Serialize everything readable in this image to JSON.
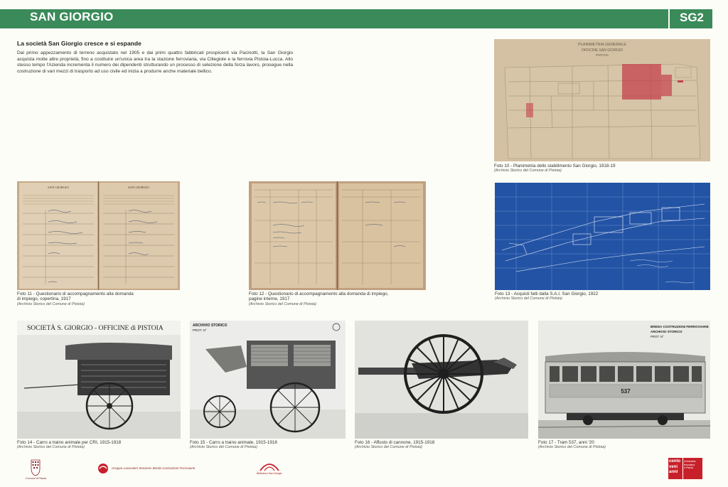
{
  "header": {
    "title": "SAN GIORGIO",
    "code": "SG2"
  },
  "section": {
    "subtitle": "La società San Giorgio cresce e si espande",
    "intro": "Dal primo appezzamento di terreno acquistato nel 1905 e dai primi quattro fabbricati prospicenti via Pacinotti, la San Giorgio acquista molte altre proprietà, fino a costituire un'unica area tra la stazione ferroviaria, via Ciliegiole e la ferrovia Pistoia-Lucca. Allo stesso tempo l'Azienda incrementa il numero dei dipendenti strutturando un processo di selezione della forza lavoro, prosegue nella costruzione di vari mezzi di trasporto ad uso civile ed inizia a produrre anche materiale bellico."
  },
  "photos": {
    "f10": {
      "caption": "Foto 10 - Planimetria dello stabilimento San Giorgio, 1918-19",
      "source": "(Archivio Storico del Comune di Pistoia)",
      "doc_title": "PLANIMETRIA GENERALE",
      "doc_sub": "OFFICINE SAN GIORGIO",
      "doc_city": "PISTOIA"
    },
    "f11": {
      "caption_line1": "Foto 11 - Questionario di accompagnamento alla domanda",
      "caption_line2": "di impiego, copertina, 1917",
      "source": "(Archivio Storico del Comune di Pistoia)",
      "doc_left_title": "SAN GIORGIO",
      "doc_right_title": "SAN GIORGIO"
    },
    "f12": {
      "caption_line1": "Foto 12 - Questionario di accompagnamento alla domanda di impiego,",
      "caption_line2": "pagine interne, 1917",
      "source": "(Archivio Storico del Comune di Pistoia)"
    },
    "f13": {
      "caption": "Foto 13 - Acquisti fatti dalla S.A.I. San Giorgio, 1922",
      "source": "(Archivio Storico del Comune di Pistoia)"
    },
    "f14": {
      "caption": "Foto 14 - Carro a traino animale per CRI, 1915-1918",
      "source": "(Archivio Storico del Comune di Pistoia)",
      "banner": "SOCIETÀ S. GIORGIO - OFFICINE di PISTOIA"
    },
    "f15": {
      "caption": "Foto 15 - Carro a traino animale, 1915-1918",
      "source": "(Archivio Storico del Comune di Pistoia)",
      "stamp1": "ARCHIVIO STORICO",
      "stamp2": "PROT. N°"
    },
    "f16": {
      "caption": "Foto 16 - Affusto di cannone, 1915-1918",
      "source": "(Archivio Storico del Comune di Pistoia)"
    },
    "f17": {
      "caption": "Foto 17 - Tram 537, anni '20",
      "source": "(Archivio Storico del Comune di Pistoia)",
      "stamp1": "BREDA COSTRUZIONI FERROVIARIE",
      "stamp2": "ARCHIVIO STORICO",
      "stamp3": "PROT. N°",
      "tram_number": "537"
    }
  },
  "footer": {
    "logo1_text": "Comune di Pistoia",
    "logo2_text": "Gruppo Lavoratori Seniores Breda Costruzioni Ferroviarie",
    "logo3_text": "Biblioteca San Giorgio",
    "logo4_lines": [
      "cento",
      "veni",
      "anni"
    ],
    "logo4_side": [
      "di industria",
      "ferroviaria",
      "a Pistoia"
    ]
  },
  "colors": {
    "accent": "#3b8a5a",
    "background": "#fdfdf7",
    "blueprint": "#1f4fa0",
    "logo_red": "#c8202a"
  }
}
